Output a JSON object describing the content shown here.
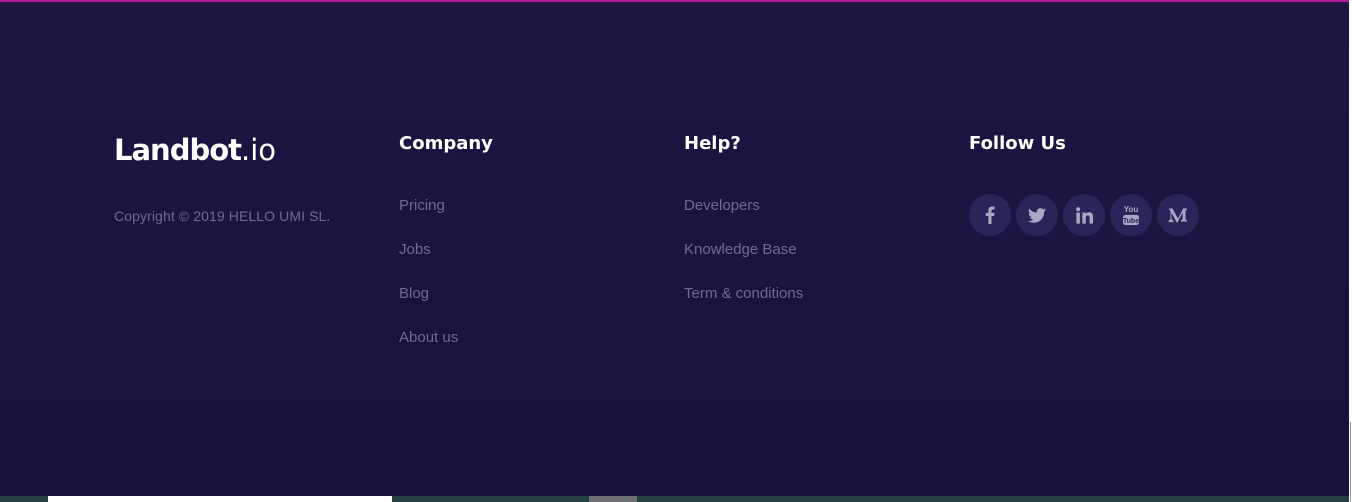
{
  "brand": {
    "logo_main": "Landbot",
    "logo_suffix": ".io",
    "copyright": "Copyright © 2019 HELLO UMI SL."
  },
  "company": {
    "title": "Company",
    "links": [
      "Pricing",
      "Jobs",
      "Blog",
      "About us"
    ]
  },
  "help": {
    "title": "Help?",
    "links": [
      "Developers",
      "Knowledge Base",
      "Term & conditions"
    ]
  },
  "follow": {
    "title": "Follow Us",
    "icons": [
      "facebook-icon",
      "twitter-icon",
      "linkedin-icon",
      "youtube-icon",
      "medium-icon"
    ],
    "youtube_text_top": "You",
    "youtube_text_bottom": "Tube"
  },
  "colors": {
    "background": "#1a1440",
    "accent_line": "#b0199a",
    "link": "#6f6a93",
    "social_bg": "#2a2559"
  }
}
